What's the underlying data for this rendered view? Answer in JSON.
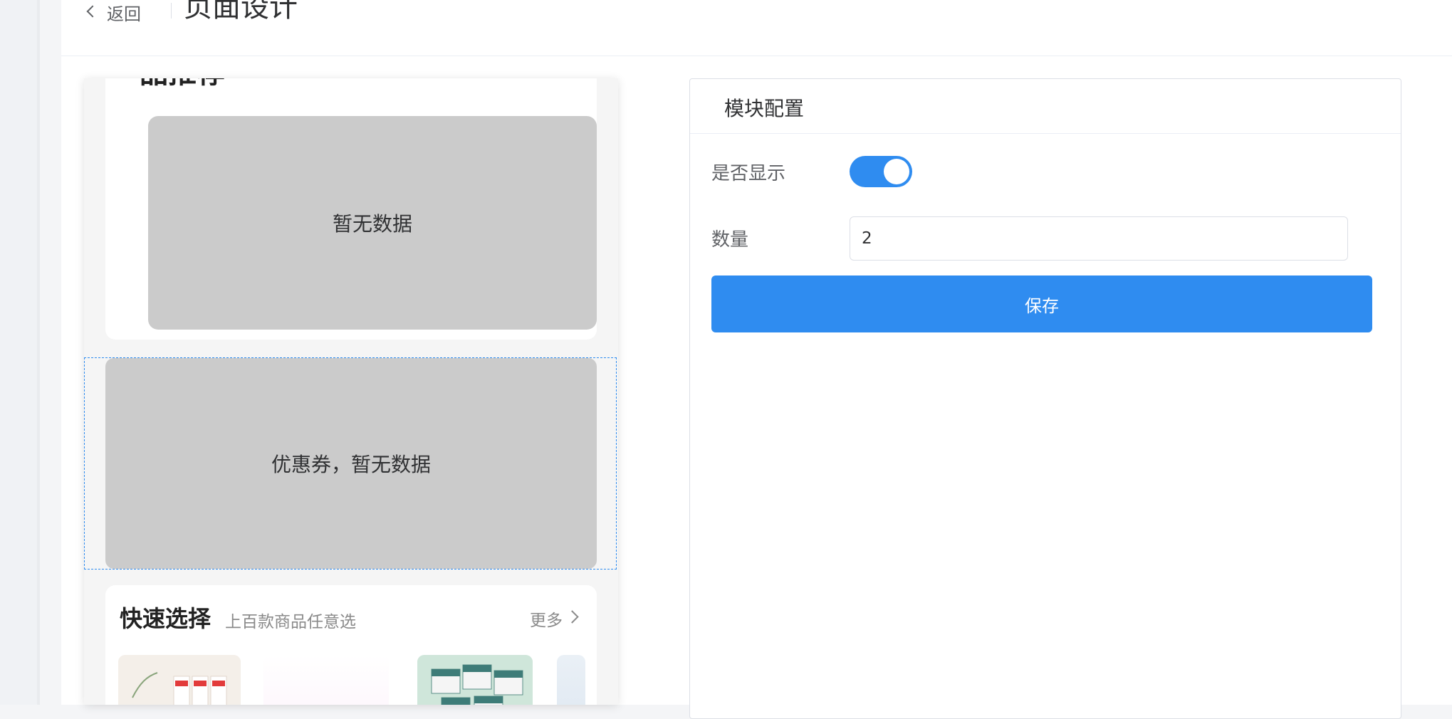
{
  "header": {
    "back_label": "返回",
    "title": "页面设计"
  },
  "preview": {
    "top_card": {
      "title_cut": "品推荐",
      "empty_text": "暂无数据"
    },
    "coupon": {
      "empty_text": "优惠券，暂无数据"
    },
    "quick_select": {
      "title": "快速选择",
      "subtitle": "上百款商品任意选",
      "more_label": "更多",
      "chevron_icon": "chevron-right-icon"
    }
  },
  "config": {
    "title": "模块配置",
    "show": {
      "label": "是否显示",
      "value": true
    },
    "count": {
      "label": "数量",
      "value": "2"
    },
    "save_label": "保存"
  },
  "colors": {
    "primary": "#2f8cf0",
    "empty_box": "#cbcbcb",
    "border": "#dcdfe6"
  }
}
